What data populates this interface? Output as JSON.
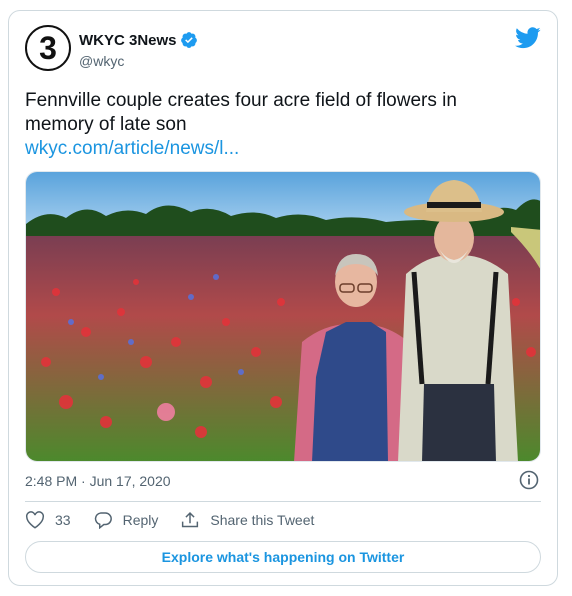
{
  "account": {
    "avatar_text": "3",
    "display_name": "WKYC 3News",
    "handle": "@wkyc"
  },
  "tweet": {
    "text": "Fennville couple creates four acre field of flowers in memory of late son",
    "link": "wkyc.com/article/news/l...",
    "timestamp": "2:48 PM · Jun 17, 2020"
  },
  "actions": {
    "like_count": "33",
    "reply_label": "Reply",
    "share_label": "Share this Tweet"
  },
  "footer": {
    "explore_label": "Explore what's happening on Twitter"
  },
  "icons": {
    "twitter": "twitter-bird-icon",
    "verified": "verified-badge-icon",
    "info": "info-icon",
    "like": "heart-icon",
    "reply": "reply-icon",
    "share": "share-icon"
  },
  "colors": {
    "brand_blue": "#1d9bf0",
    "link_blue": "#1b95e0",
    "text": "#0f1419",
    "muted": "#536471",
    "border": "#cfd9de"
  }
}
